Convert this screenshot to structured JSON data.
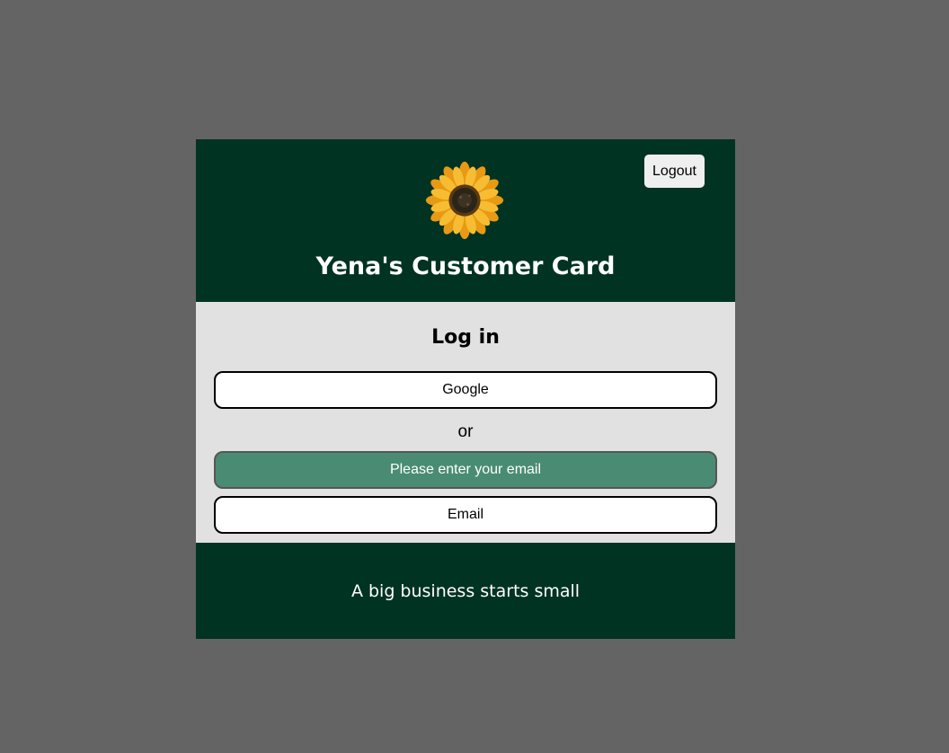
{
  "header": {
    "logout_label": "Logout",
    "logo_icon": "sunflower-icon",
    "title": "Yena's Customer Card"
  },
  "login": {
    "heading": "Log in",
    "google_label": "Google",
    "or_label": "or",
    "email_placeholder": "Please enter your email",
    "email_value": "",
    "email_button_label": "Email"
  },
  "footer": {
    "tagline": "A big business starts small"
  },
  "colors": {
    "page_background": "#646464",
    "brand_dark_green": "#003322",
    "panel_gray": "#e1e1e1",
    "input_green": "#4a8c73",
    "petal_yellow": "#f2a61c"
  }
}
